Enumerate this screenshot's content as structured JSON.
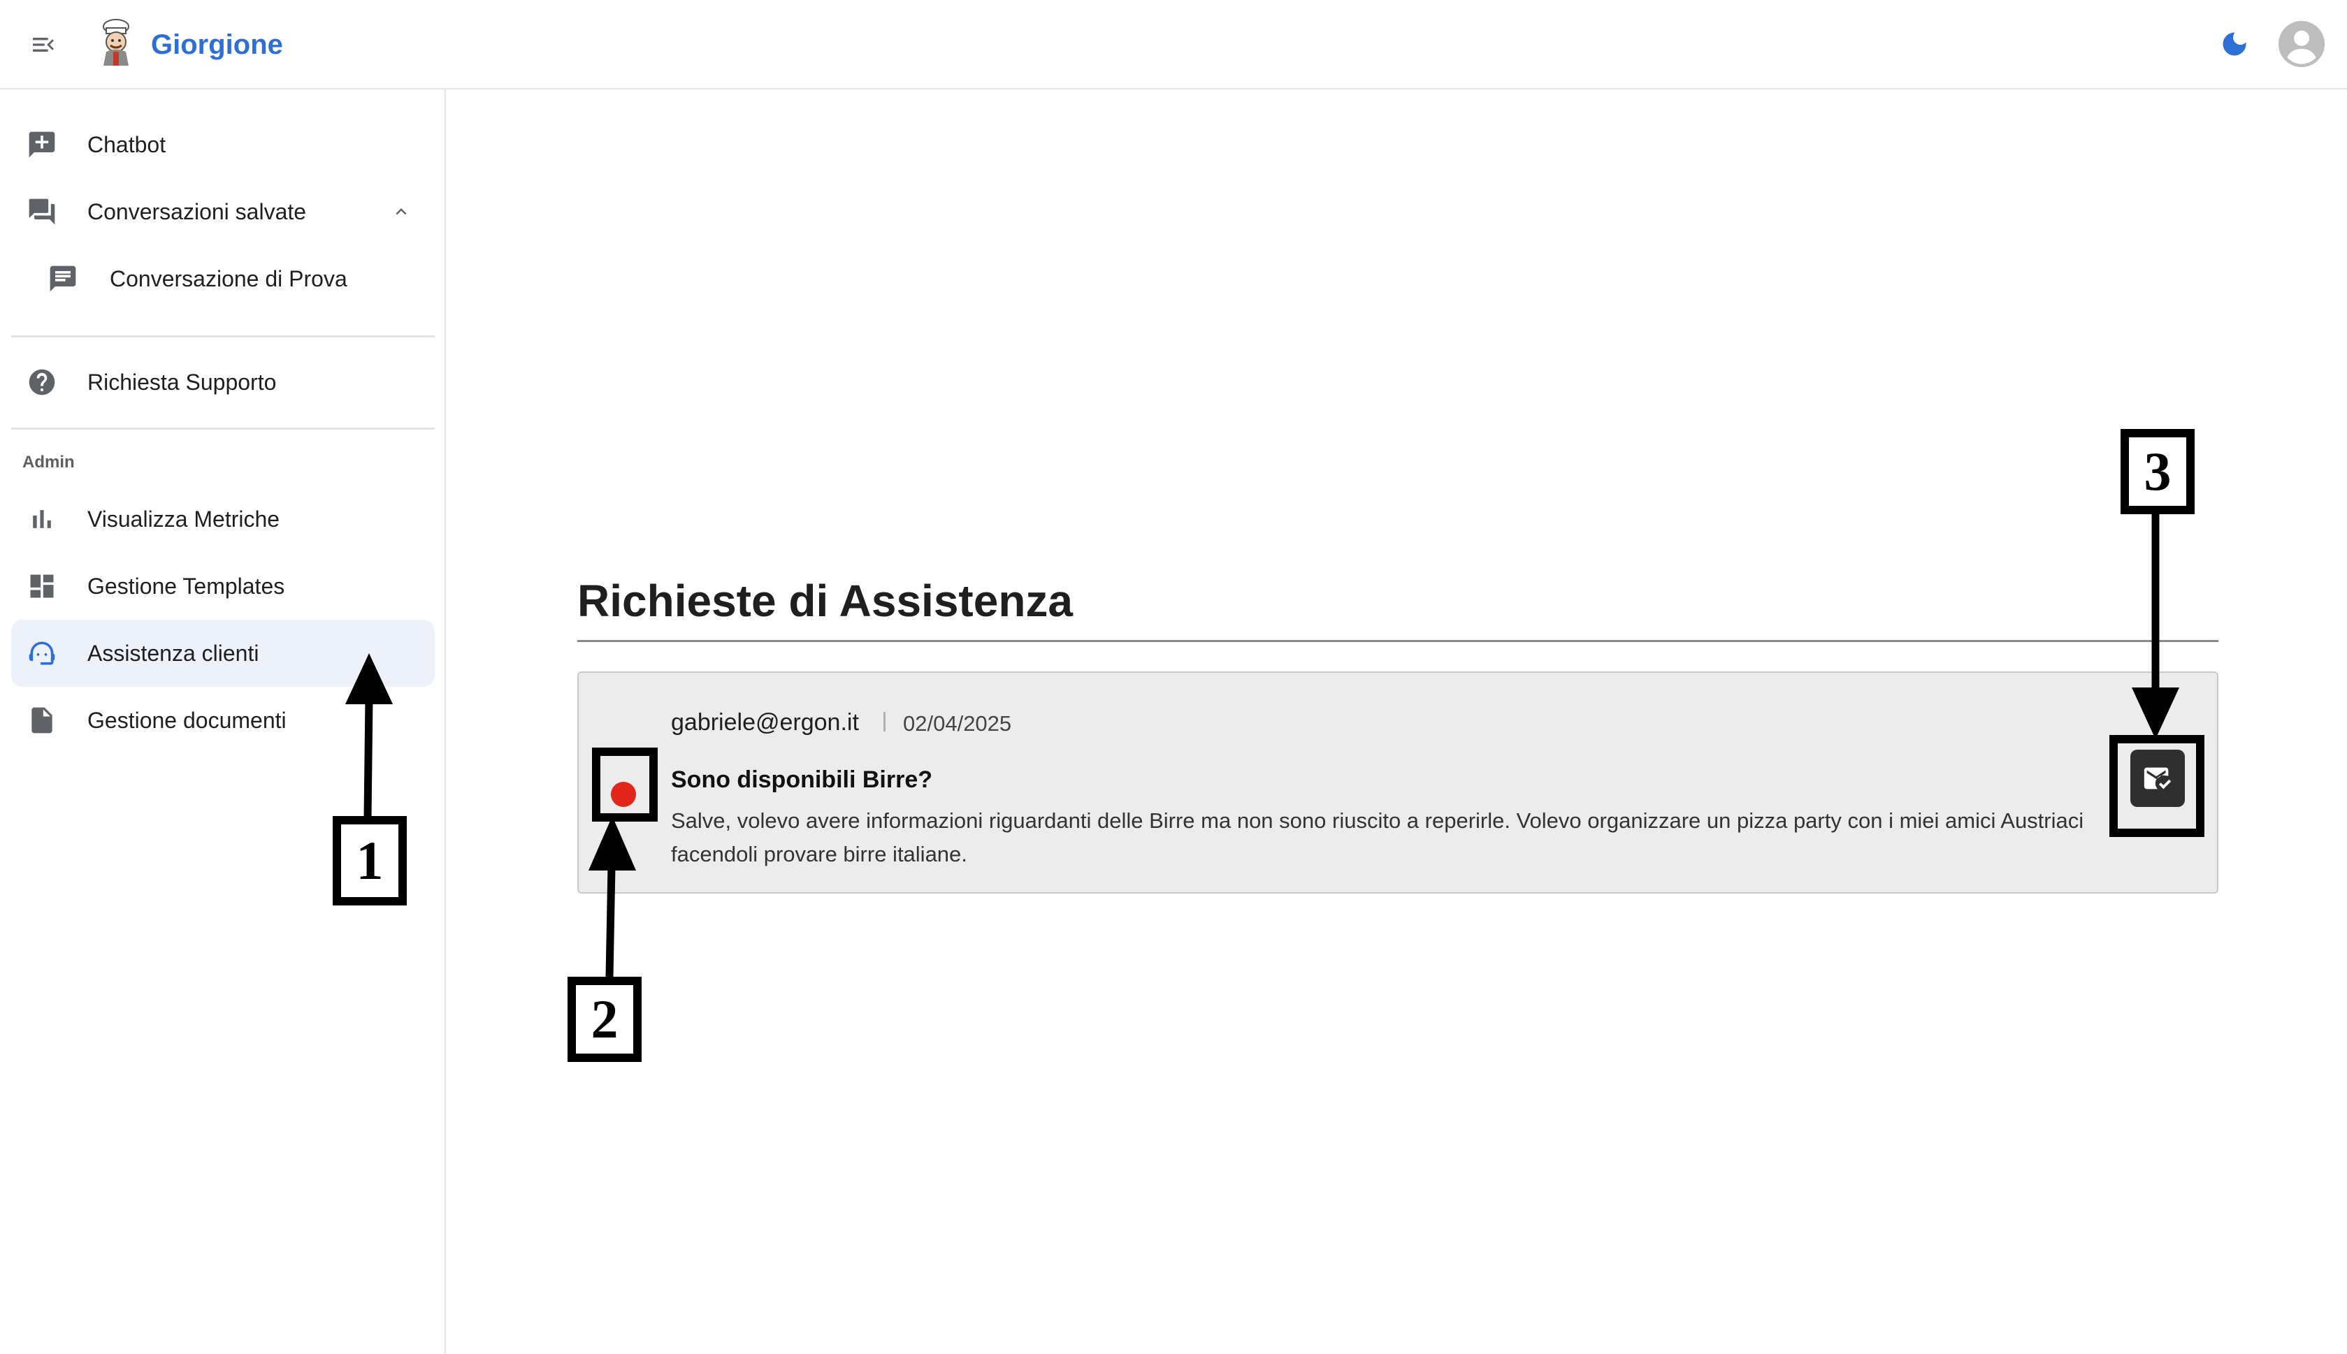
{
  "header": {
    "brand": "Giorgione",
    "logo_icon": "chef-mascot-logo",
    "menu_icon": "menu-collapse-icon",
    "theme_icon": "moon-icon",
    "avatar_icon": "account-circle-icon",
    "brand_color": "#2e6fd6"
  },
  "sidebar": {
    "chatbot": {
      "label": "Chatbot",
      "icon": "add-comment-icon"
    },
    "saved_conversations": {
      "label": "Conversazioni salvate",
      "icon": "forum-icon",
      "expanded": true
    },
    "saved_items": [
      {
        "label": "Conversazione di Prova",
        "icon": "chat-icon"
      }
    ],
    "support": {
      "label": "Richiesta Supporto",
      "icon": "help-icon"
    },
    "admin_section": "Admin",
    "admin_items": [
      {
        "label": "Visualizza Metriche",
        "icon": "bar-chart-icon"
      },
      {
        "label": "Gestione Templates",
        "icon": "dashboard-icon"
      },
      {
        "label": "Assistenza clienti",
        "icon": "support-agent-icon",
        "active": true
      },
      {
        "label": "Gestione documenti",
        "icon": "document-icon"
      }
    ],
    "active_color": "#edf2fa"
  },
  "main": {
    "title": "Richieste di Assistenza",
    "requests": [
      {
        "email": "gabriele@ergon.it",
        "date": "02/04/2025",
        "subject": "Sono disponibili Birre?",
        "message": "Salve, volevo avere informazioni riguardanti delle Birre ma non sono riuscito a reperirle. Volevo organizzare un pizza party con i miei amici Austriaci facendoli provare birre italiane.",
        "status": "unresolved",
        "status_color": "#e3261c",
        "action_icon": "mark-email-read-icon"
      }
    ]
  },
  "annotations": {
    "one": "1",
    "two": "2",
    "three": "3"
  }
}
